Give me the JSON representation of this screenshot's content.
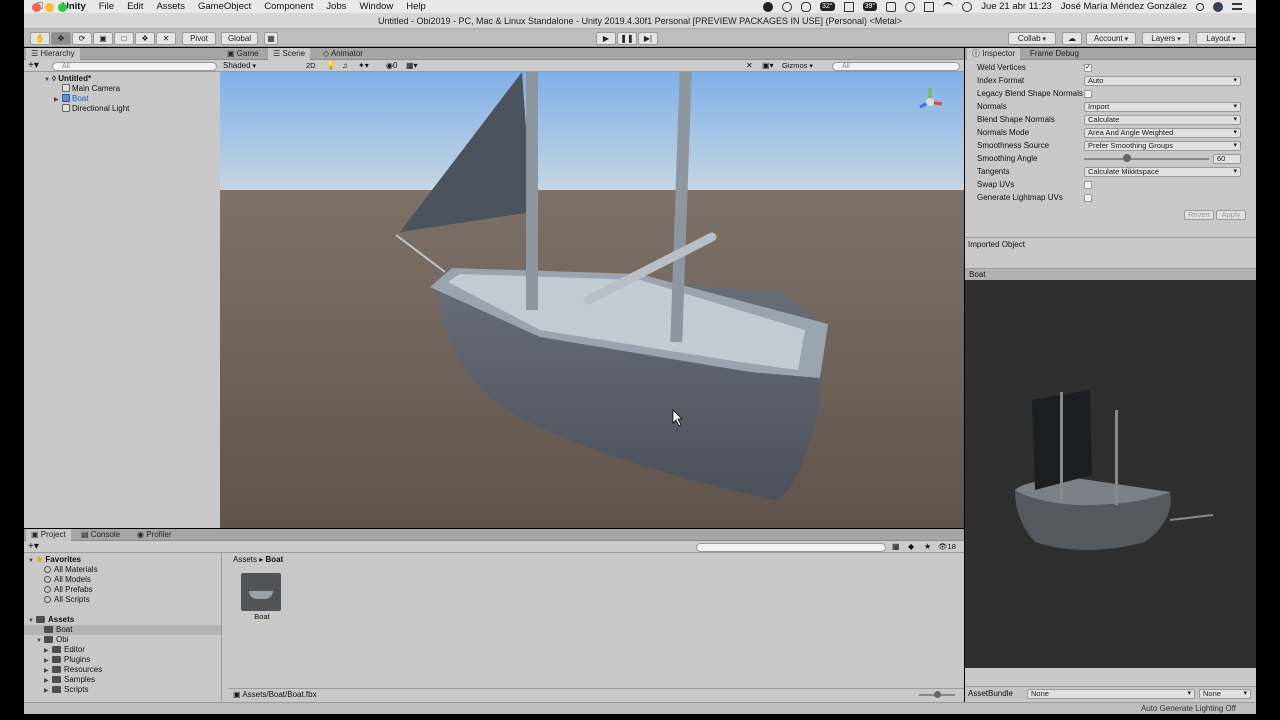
{
  "menubar": {
    "items": [
      "Unity",
      "File",
      "Edit",
      "Assets",
      "GameObject",
      "Component",
      "Jobs",
      "Window",
      "Help"
    ],
    "clock": "Jue 21 abr  11:23",
    "user": "José María Méndez González",
    "badges": [
      "32°",
      "39°"
    ]
  },
  "window": {
    "title": "Untitled - Obi2019 - PC, Mac & Linux Standalone - Unity 2019.4.30f1 Personal [PREVIEW PACKAGES IN USE] (Personal) <Metal>"
  },
  "toolbar": {
    "pivot": "Pivot",
    "global": "Global",
    "collab": "Collab",
    "account": "Account",
    "layers": "Layers",
    "layout": "Layout"
  },
  "hierarchy": {
    "tab": "Hierarchy",
    "search_placeholder": "All",
    "scene": "Untitled*",
    "items": [
      "Main Camera",
      "Boat",
      "Directional Light"
    ]
  },
  "scene_view": {
    "tabs": [
      "Game",
      "Scene",
      "Animator"
    ],
    "shading": "Shaded",
    "mode_2d": "2D",
    "fx_count": "0",
    "gizmos": "Gizmos",
    "search_placeholder": "All"
  },
  "inspector": {
    "tabs": [
      "Inspector",
      "Frame Debug"
    ],
    "rows": [
      {
        "label": "Weld Vertices",
        "type": "check",
        "checked": true
      },
      {
        "label": "Index Format",
        "type": "dropdown",
        "value": "Auto"
      },
      {
        "label": "Legacy Blend Shape Normals",
        "type": "check",
        "checked": false
      },
      {
        "label": "Normals",
        "type": "dropdown",
        "value": "Import"
      },
      {
        "label": "Blend Shape Normals",
        "type": "dropdown",
        "value": "Calculate"
      },
      {
        "label": "Normals Mode",
        "type": "dropdown",
        "value": "Area And Angle Weighted"
      },
      {
        "label": "Smoothness Source",
        "type": "dropdown",
        "value": "Prefer Smoothing Groups"
      },
      {
        "label": "Smoothing Angle",
        "type": "slider",
        "value": "60"
      },
      {
        "label": "Tangents",
        "type": "dropdown",
        "value": "Calculate Mikktspace"
      },
      {
        "label": "Swap UVs",
        "type": "check",
        "checked": false
      },
      {
        "label": "Generate Lightmap UVs",
        "type": "check",
        "checked": false
      }
    ],
    "revert": "Revert",
    "apply": "Apply",
    "imported_object": "Imported Object",
    "preview_title": "Boat",
    "assetbundle_label": "AssetBundle",
    "assetbundle_value": "None",
    "assetbundle_variant": "None"
  },
  "project": {
    "tabs": [
      "Project",
      "Console",
      "Profiler"
    ],
    "favorites_label": "Favorites",
    "favorites": [
      "All Materials",
      "All Models",
      "All Prefabs",
      "All Scripts"
    ],
    "assets_label": "Assets",
    "asset_tree": [
      "Boat",
      "Obi",
      "Editor",
      "Plugins",
      "Resources",
      "Samples",
      "Scripts"
    ],
    "breadcrumb": [
      "Assets",
      "Boat"
    ],
    "file_label": "Boat",
    "path": "Assets/Boat/Boat.fbx",
    "count": "18"
  },
  "status": {
    "right": "Auto Generate Lighting Off"
  }
}
